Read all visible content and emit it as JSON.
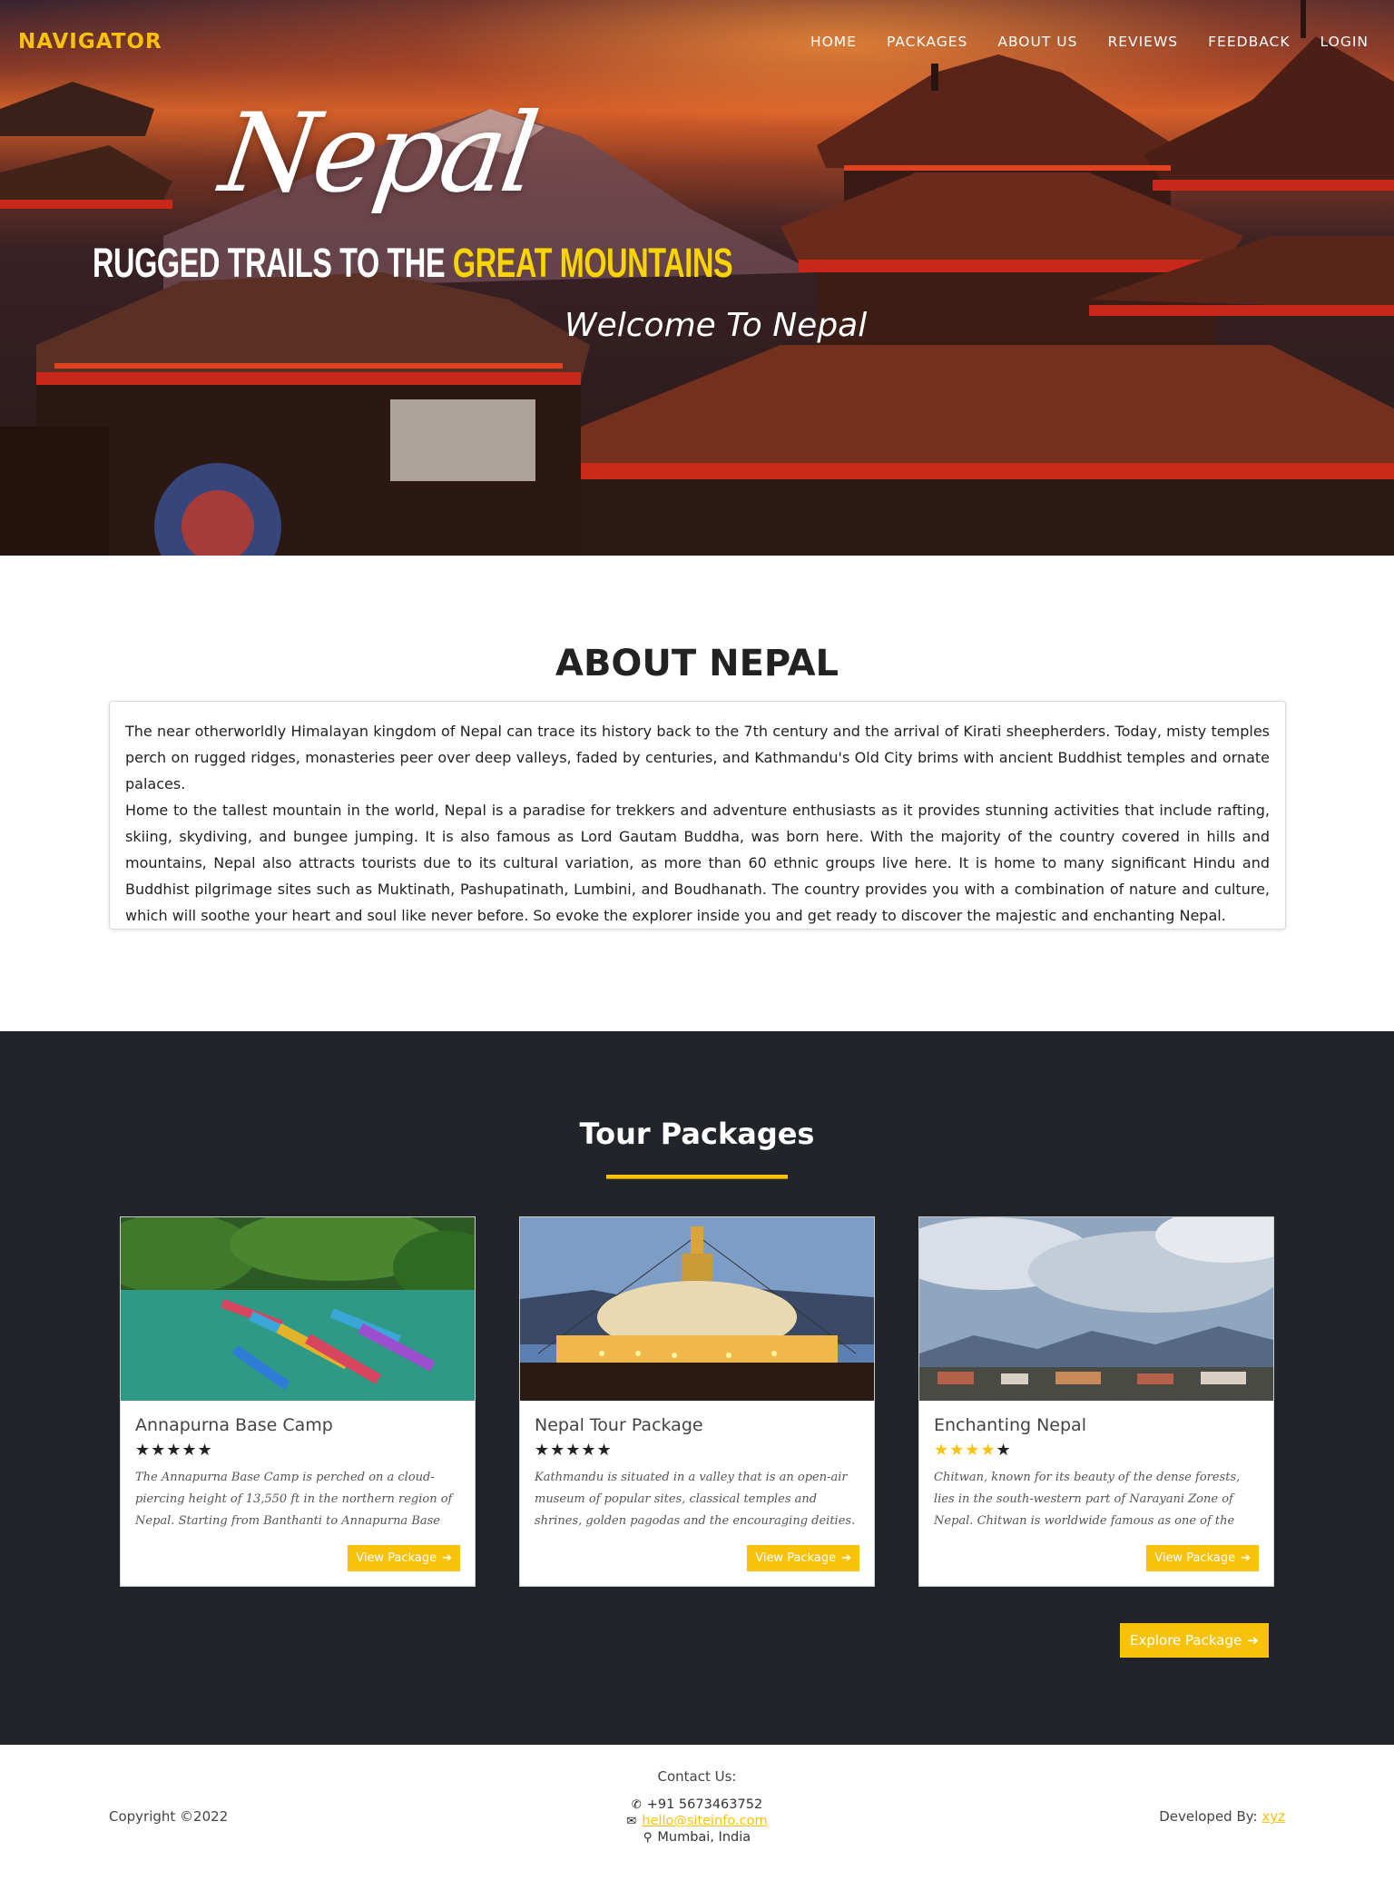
{
  "nav": {
    "brand": "NAVIGATOR",
    "links": [
      "HOME",
      "PACKAGES",
      "ABOUT US",
      "REVIEWS",
      "FEEDBACK",
      "LOGIN"
    ]
  },
  "hero": {
    "script_title": "Nepal",
    "headline_white": "RUGGED TRAILS TO THE ",
    "headline_accent": "GREAT MOUNTAINS",
    "welcome": "Welcome To Nepal"
  },
  "about": {
    "title": "ABOUT NEPAL",
    "paragraph1": "The near otherworldly Himalayan kingdom of Nepal can trace its history back to the 7th century and the arrival of Kirati sheepherders. Today, misty temples perch on rugged ridges, monasteries peer over deep valleys, faded by centuries, and Kathmandu's Old City brims with ancient Buddhist temples and ornate palaces.",
    "paragraph2": "Home to the tallest mountain in the world, Nepal is a paradise for trekkers and adventure enthusiasts as it provides stunning activities that include rafting, skiing, skydiving, and bungee jumping. It is also famous as Lord Gautam Buddha, was born here. With the majority of the country covered in hills and mountains, Nepal also attracts tourists due to its cultural variation, as more than 60 ethnic groups live here. It is home to many significant Hindu and Buddhist pilgrimage sites such as Muktinath, Pashupatinath, Lumbini, and Boudhanath. The country provides you with a combination of nature and culture, which will soothe your heart and soul like never before. So evoke the explorer inside you and get ready to discover the majestic and enchanting Nepal."
  },
  "packages": {
    "title": "Tour Packages",
    "cards": [
      {
        "name": "Annapurna Base Camp",
        "rating": 5,
        "rating_color": "#222222",
        "stars": "★★★★★",
        "description": "The Annapurna Base Camp is perched on a cloud-piercing height of 13,550 ft in the northern region of Nepal. Starting from Banthanti to Annapurna Base Camp offers a stunning...",
        "button": "View Package",
        "image_icon": "lake-boats-image"
      },
      {
        "name": "Nepal Tour Package",
        "rating": 5,
        "rating_color": "#222222",
        "stars": "★★★★★",
        "description": "Kathmandu is situated in a valley that is an open-air museum of popular sites, classical temples and shrines, golden pagodas and the encouraging deities. The city's infinite traditional...",
        "button": "View Package",
        "image_icon": "stupa-night-image"
      },
      {
        "name": "Enchanting Nepal",
        "rating": 4,
        "rating_color": "#f8c20a",
        "stars_gold": "★★★★",
        "stars_dark": "★",
        "description": "Chitwan, known for its beauty of the dense forests, lies in the south-western part of Narayani Zone of Nepal. Chitwan is worldwide famous as one of the best wildlife-viewings. Best...",
        "button": "View Package",
        "image_icon": "cloudy-hills-image"
      }
    ],
    "explore_button": "Explore Package"
  },
  "footer": {
    "copyright": "Copyright ©2022",
    "contact_title": "Contact Us:",
    "phone": "+91 5673463752",
    "email": "hello@siteinfo.com",
    "location": "Mumbai, India",
    "developed_label": "Developed By: ",
    "developer": "xyz"
  },
  "colors": {
    "accent": "#f8c20a",
    "dark_section": "#212529"
  }
}
